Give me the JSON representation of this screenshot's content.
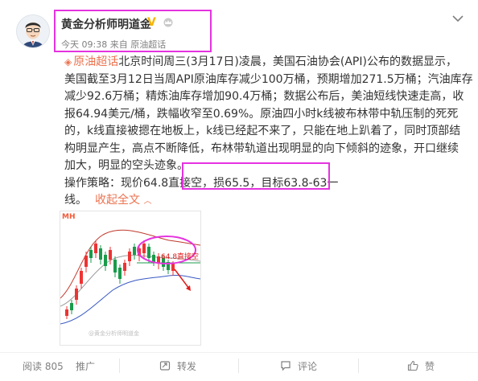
{
  "post": {
    "author": "黄金分析师明道金",
    "time": "今天 09:38",
    "from_word": "来自",
    "source": "原油超话",
    "topic": "原油超话",
    "lines": [
      "北京时间周三(3月17日)凌晨，美国石油协会(API)公布的数据显示，",
      "美国截至3月12日当周API原油库存减少100万桶，预期增加271.5万桶；汽油库存",
      "减少92.6万桶；精炼油库存增加90.4万桶；数据公布后，美油短线快速走高，收",
      "报64.94美元/桶，跌幅收窄至0.69%。原油四小时k线被布林带中轨压制的死死",
      "的，k线直接被摁在地板上，k线已经起不来了，只能在地上趴着了，同时顶部结",
      "构明显产生，高点不断降低，布林带轨道出现明显的向下倾斜的迹象，开口继续",
      "加大，明显的空头迹象。"
    ],
    "strategy": "操作策略：现价64.8直接空",
    "tail": "，损65.5，目标63.8-63一",
    "last_line": "线。",
    "collapse": "收起全文",
    "icons": {
      "verified": "verified-v-icon",
      "crown": "crown-icon",
      "more": "chevron-down-icon",
      "topic": "topic-diamond-icon"
    },
    "accent_color": "#eb7350",
    "highlight_color": "#e533e0"
  },
  "image": {
    "logo": "MH",
    "annotation": "64.8直接空",
    "watermark": "@黄金分析师明道金"
  },
  "footer": {
    "reads": "阅读 805",
    "promote": "推广",
    "repost": "转发",
    "comment": "评论",
    "like": "赞"
  }
}
